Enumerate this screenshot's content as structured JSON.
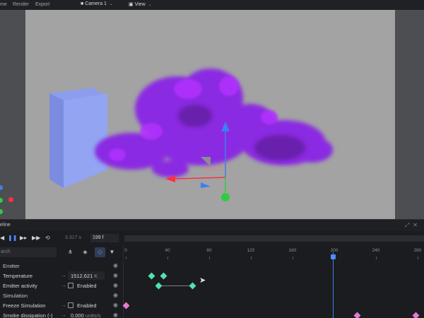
{
  "menu": {
    "items": [
      "me",
      "Render",
      "Export"
    ],
    "camera_label": "Camera 1",
    "view_label": "View"
  },
  "timeline": {
    "title": "eline",
    "current_frame": "3.317 s",
    "end_frame": "199 f",
    "search_placeholder": "arch",
    "ruler_ticks": [
      "0",
      "40",
      "80",
      "120",
      "160",
      "200",
      "240",
      "280"
    ],
    "rows": [
      {
        "name": "Emitter",
        "type": "group"
      },
      {
        "name": "Temperature",
        "value": "1512.621",
        "unit": "K"
      },
      {
        "name": "Emitter activity",
        "checkbox_label": "Enabled"
      },
      {
        "name": "Simulation",
        "type": "group"
      },
      {
        "name": "Freeze Simulation",
        "checkbox_label": "Enabled"
      },
      {
        "name": "Smoke dissipation (-)",
        "value": "0.000",
        "unit": "units/s"
      }
    ]
  },
  "viewport": {
    "smoke_color": "#8a2be2",
    "emitter_color": "#8c9dee",
    "background": "#a3a3a4"
  },
  "colors": {
    "accent": "#4c8df6",
    "keyframe_teal": "#54e0b0",
    "keyframe_pink": "#e07bd8"
  }
}
